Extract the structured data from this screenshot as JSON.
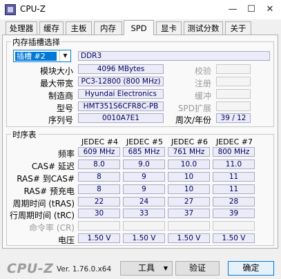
{
  "window": {
    "title": "CPU-Z",
    "minimize": "—",
    "maximize": "☐",
    "close": "✕"
  },
  "tabs": [
    "处理器",
    "缓存",
    "主板",
    "内存",
    "SPD",
    "显卡",
    "测试分数",
    "关于"
  ],
  "slot_group": {
    "title": "内存插槽选择",
    "slot_value": "插槽 #2",
    "mem_type": "DDR3",
    "fields": [
      {
        "label": "模块大小",
        "value": "4096 MBytes"
      },
      {
        "label": "最大带宽",
        "value": "PC3-12800 (800 MHz)"
      },
      {
        "label": "制造商",
        "value": "Hyundai Electronics"
      },
      {
        "label": "型号",
        "value": "HMT351S6CFR8C-PB"
      },
      {
        "label": "序列号",
        "value": "0010A7E1"
      }
    ],
    "right_fields": [
      {
        "label": "校验",
        "value": ""
      },
      {
        "label": "注册",
        "value": ""
      },
      {
        "label": "缓冲",
        "value": ""
      },
      {
        "label": "SPD扩展",
        "value": ""
      },
      {
        "label": "周次/年份",
        "value": "39 / 12"
      }
    ]
  },
  "timing_group": {
    "title": "时序表",
    "columns": [
      "JEDEC #4",
      "JEDEC #5",
      "JEDEC #6",
      "JEDEC #7"
    ],
    "rows": [
      {
        "label": "频率",
        "values": [
          "609 MHz",
          "685 MHz",
          "761 MHz",
          "800 MHz"
        ]
      },
      {
        "label": "CAS# 延迟",
        "values": [
          "8.0",
          "9.0",
          "10.0",
          "11.0"
        ]
      },
      {
        "label": "RAS# 到CAS#",
        "values": [
          "8",
          "9",
          "10",
          "11"
        ]
      },
      {
        "label": "RAS# 预充电",
        "values": [
          "8",
          "9",
          "10",
          "11"
        ]
      },
      {
        "label": "周期时间 (tRAS)",
        "values": [
          "22",
          "24",
          "27",
          "28"
        ]
      },
      {
        "label": "行周期时间 (tRC)",
        "values": [
          "30",
          "33",
          "37",
          "39"
        ]
      },
      {
        "label": "命令率 (CR)",
        "values": [
          "",
          "",
          "",
          ""
        ]
      },
      {
        "label": "电压",
        "values": [
          "1.50 V",
          "1.50 V",
          "1.50 V",
          "1.50 V"
        ]
      }
    ]
  },
  "footer": {
    "brand": "CPU-Z",
    "version": "Ver. 1.76.0.x64",
    "tools_button": "工具",
    "tools_arrow": "▼",
    "validate_button": "验证",
    "ok_button": "确定"
  }
}
